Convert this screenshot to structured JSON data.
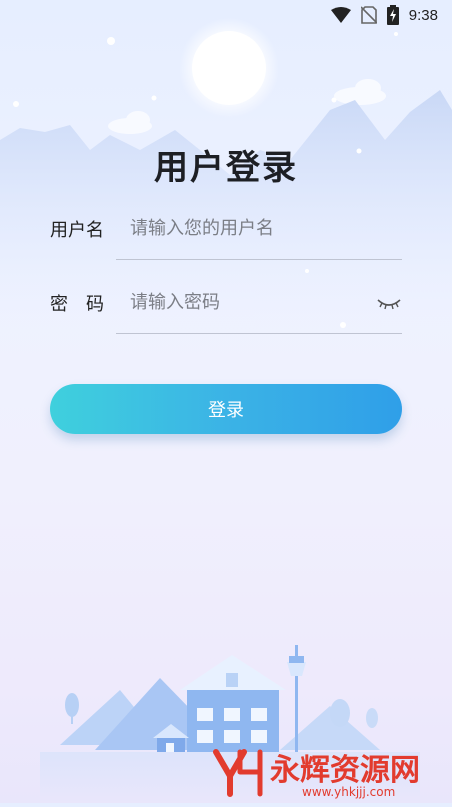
{
  "status_bar": {
    "time": "9:38"
  },
  "login": {
    "title": "用户登录",
    "username_label": "用户名",
    "username_placeholder": "请输入您的用户名",
    "password_label": "密　码",
    "password_placeholder": "请输入密码",
    "submit_label": "登录"
  },
  "watermark": {
    "brand": "永辉资源网",
    "domain": "www.yhkjjj.com"
  },
  "icons": [
    "wifi-icon",
    "no-sim-icon",
    "battery-charging-icon",
    "eye-closed-icon"
  ],
  "colors": {
    "button_start": "#3fd0dd",
    "button_end": "#2f9fe8",
    "background_top": "#e6eeff"
  }
}
